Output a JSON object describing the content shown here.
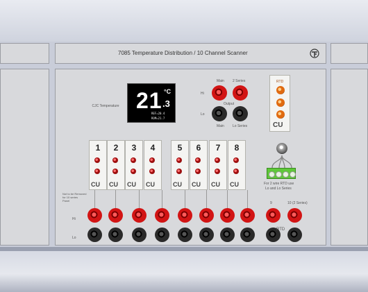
{
  "header": {
    "title": "7085 Temperature Distribution / 10 Channel Scanner",
    "logo": "TP-logo"
  },
  "display": {
    "left_caption": "CJC Temperature",
    "temperature": "21",
    "unit": "°C",
    "decimal": ".3",
    "line1": "REF=20.4",
    "line2": "ROM=21.7"
  },
  "output": {
    "top_left": "Main",
    "top_right": "2 Series",
    "middle": "Output",
    "bottom_left": "Main",
    "bottom_right": "Lo Series",
    "row_hi": "Hi",
    "row_lo": "Lo"
  },
  "rtd_box": {
    "label": "RTD",
    "cu": "CU"
  },
  "channels": [
    "1",
    "2",
    "3",
    "4",
    "5",
    "6",
    "7",
    "8"
  ],
  "card_cu": "CU",
  "green_terminal": {
    "text1": "For 2 wire RTD use",
    "text2": "Lo and Lo Series"
  },
  "left_notes": [
    "Not to be Removed",
    "for 10 series",
    "Panel"
  ],
  "bottom_labels": {
    "row_hi": "Hi",
    "row_lo": "Lo",
    "ch9": "9",
    "ch10": "10 (2 Series)",
    "rtd": "RTD"
  },
  "colors": {
    "panel": "#d8d9dc",
    "jack_red": "#d21414",
    "jack_black": "#1a1a1a",
    "terminal_green": "#5fc83a"
  }
}
